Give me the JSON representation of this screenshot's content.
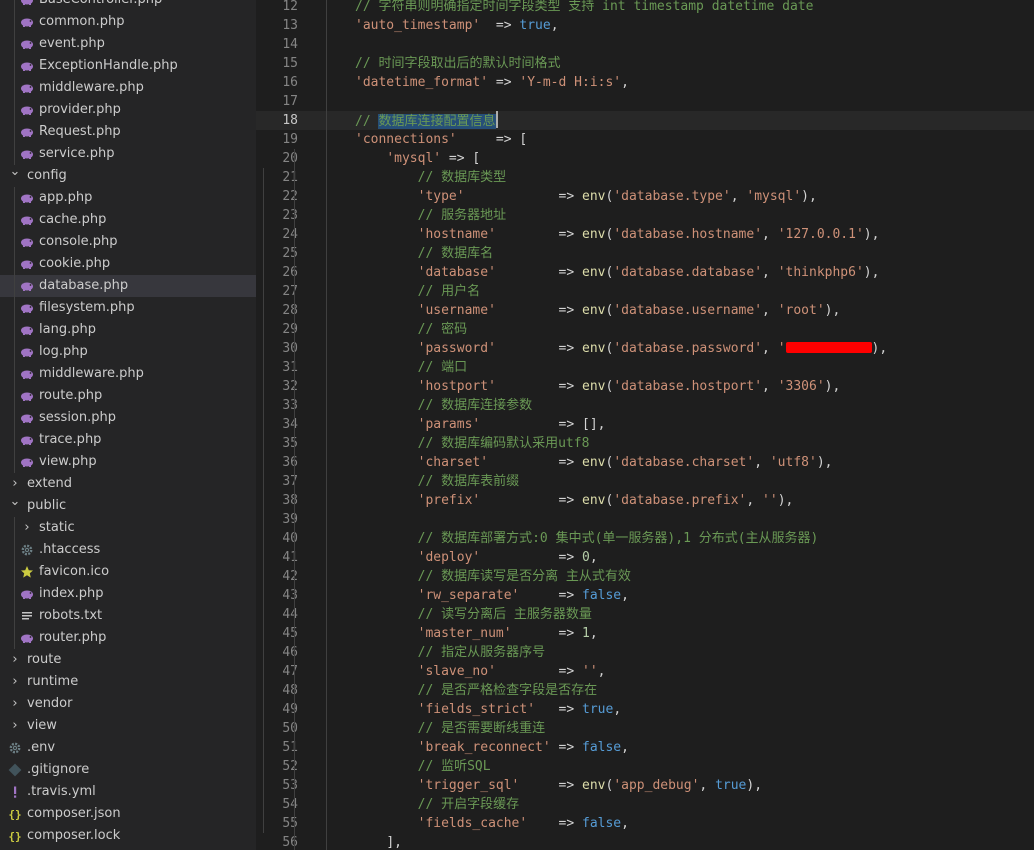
{
  "explorer": {
    "items": [
      {
        "label": "BaseController.php",
        "type": "php",
        "depth": 1
      },
      {
        "label": "common.php",
        "type": "php",
        "depth": 1
      },
      {
        "label": "event.php",
        "type": "php",
        "depth": 1
      },
      {
        "label": "ExceptionHandle.php",
        "type": "php",
        "depth": 1
      },
      {
        "label": "middleware.php",
        "type": "php",
        "depth": 1
      },
      {
        "label": "provider.php",
        "type": "php",
        "depth": 1
      },
      {
        "label": "Request.php",
        "type": "php",
        "depth": 1
      },
      {
        "label": "service.php",
        "type": "php",
        "depth": 1
      },
      {
        "label": "config",
        "type": "folder-open",
        "depth": 0
      },
      {
        "label": "app.php",
        "type": "php",
        "depth": 1
      },
      {
        "label": "cache.php",
        "type": "php",
        "depth": 1
      },
      {
        "label": "console.php",
        "type": "php",
        "depth": 1
      },
      {
        "label": "cookie.php",
        "type": "php",
        "depth": 1
      },
      {
        "label": "database.php",
        "type": "php",
        "depth": 1,
        "selected": true
      },
      {
        "label": "filesystem.php",
        "type": "php",
        "depth": 1
      },
      {
        "label": "lang.php",
        "type": "php",
        "depth": 1
      },
      {
        "label": "log.php",
        "type": "php",
        "depth": 1
      },
      {
        "label": "middleware.php",
        "type": "php",
        "depth": 1
      },
      {
        "label": "route.php",
        "type": "php",
        "depth": 1
      },
      {
        "label": "session.php",
        "type": "php",
        "depth": 1
      },
      {
        "label": "trace.php",
        "type": "php",
        "depth": 1
      },
      {
        "label": "view.php",
        "type": "php",
        "depth": 1
      },
      {
        "label": "extend",
        "type": "folder-closed",
        "depth": 0
      },
      {
        "label": "public",
        "type": "folder-open",
        "depth": 0
      },
      {
        "label": "static",
        "type": "folder-closed",
        "depth": 1
      },
      {
        "label": ".htaccess",
        "type": "gear",
        "depth": 1
      },
      {
        "label": "favicon.ico",
        "type": "star",
        "depth": 1
      },
      {
        "label": "index.php",
        "type": "php",
        "depth": 1
      },
      {
        "label": "robots.txt",
        "type": "text",
        "depth": 1
      },
      {
        "label": "router.php",
        "type": "php",
        "depth": 1
      },
      {
        "label": "route",
        "type": "folder-closed",
        "depth": 0
      },
      {
        "label": "runtime",
        "type": "folder-closed",
        "depth": 0
      },
      {
        "label": "vendor",
        "type": "folder-closed",
        "depth": 0
      },
      {
        "label": "view",
        "type": "folder-closed",
        "depth": 0
      },
      {
        "label": ".env",
        "type": "gear",
        "depth": 0
      },
      {
        "label": ".gitignore",
        "type": "git",
        "depth": 0
      },
      {
        "label": ".travis.yml",
        "type": "yaml",
        "depth": 0
      },
      {
        "label": "composer.json",
        "type": "json",
        "depth": 0
      },
      {
        "label": "composer.lock",
        "type": "json",
        "depth": 0
      }
    ]
  },
  "editor": {
    "current_line": "18",
    "lines": [
      {
        "n": "12",
        "indent": 2,
        "tokens": [
          {
            "t": "// 字符串则明确指定时间字段类型 支持 int timestamp datetime date",
            "c": "cm"
          }
        ]
      },
      {
        "n": "13",
        "indent": 2,
        "tokens": [
          {
            "t": "'auto_timestamp'",
            "c": "st"
          },
          {
            "t": "  => ",
            "c": "pn"
          },
          {
            "t": "true",
            "c": "kw"
          },
          {
            "t": ",",
            "c": "pn"
          }
        ]
      },
      {
        "n": "14",
        "indent": 2,
        "tokens": []
      },
      {
        "n": "15",
        "indent": 2,
        "tokens": [
          {
            "t": "// 时间字段取出后的默认时间格式",
            "c": "cm"
          }
        ]
      },
      {
        "n": "16",
        "indent": 2,
        "tokens": [
          {
            "t": "'datetime_format'",
            "c": "st"
          },
          {
            "t": " => ",
            "c": "pn"
          },
          {
            "t": "'Y-m-d H:i:s'",
            "c": "st"
          },
          {
            "t": ",",
            "c": "pn"
          }
        ]
      },
      {
        "n": "17",
        "indent": 2,
        "tokens": []
      },
      {
        "n": "18",
        "indent": 2,
        "tokens": [
          {
            "t": "// ",
            "c": "cm"
          },
          {
            "t": "数据库连接配置信息",
            "c": "cm",
            "hl": true
          },
          {
            "cursor": true
          }
        ]
      },
      {
        "n": "19",
        "indent": 2,
        "tokens": [
          {
            "t": "'connections'",
            "c": "st"
          },
          {
            "t": "     => [",
            "c": "pn"
          }
        ]
      },
      {
        "n": "20",
        "indent": 3,
        "tokens": [
          {
            "t": "'mysql'",
            "c": "st"
          },
          {
            "t": " => [",
            "c": "pn"
          }
        ]
      },
      {
        "n": "21",
        "indent": 4,
        "tokens": [
          {
            "t": "// 数据库类型",
            "c": "cm"
          }
        ]
      },
      {
        "n": "22",
        "indent": 4,
        "tokens": [
          {
            "t": "'type'",
            "c": "st"
          },
          {
            "t": "            => ",
            "c": "pn"
          },
          {
            "t": "env",
            "c": "fn"
          },
          {
            "t": "(",
            "c": "pn"
          },
          {
            "t": "'database.type'",
            "c": "st"
          },
          {
            "t": ", ",
            "c": "pn"
          },
          {
            "t": "'mysql'",
            "c": "st"
          },
          {
            "t": "),",
            "c": "pn"
          }
        ]
      },
      {
        "n": "23",
        "indent": 4,
        "tokens": [
          {
            "t": "// 服务器地址",
            "c": "cm"
          }
        ]
      },
      {
        "n": "24",
        "indent": 4,
        "tokens": [
          {
            "t": "'hostname'",
            "c": "st"
          },
          {
            "t": "        => ",
            "c": "pn"
          },
          {
            "t": "env",
            "c": "fn"
          },
          {
            "t": "(",
            "c": "pn"
          },
          {
            "t": "'database.hostname'",
            "c": "st"
          },
          {
            "t": ", ",
            "c": "pn"
          },
          {
            "t": "'127.0.0.1'",
            "c": "st"
          },
          {
            "t": "),",
            "c": "pn"
          }
        ]
      },
      {
        "n": "25",
        "indent": 4,
        "tokens": [
          {
            "t": "// 数据库名",
            "c": "cm"
          }
        ]
      },
      {
        "n": "26",
        "indent": 4,
        "tokens": [
          {
            "t": "'database'",
            "c": "st"
          },
          {
            "t": "        => ",
            "c": "pn"
          },
          {
            "t": "env",
            "c": "fn"
          },
          {
            "t": "(",
            "c": "pn"
          },
          {
            "t": "'database.database'",
            "c": "st"
          },
          {
            "t": ", ",
            "c": "pn"
          },
          {
            "t": "'thinkphp6'",
            "c": "st"
          },
          {
            "t": "),",
            "c": "pn"
          }
        ]
      },
      {
        "n": "27",
        "indent": 4,
        "tokens": [
          {
            "t": "// 用户名",
            "c": "cm"
          }
        ]
      },
      {
        "n": "28",
        "indent": 4,
        "tokens": [
          {
            "t": "'username'",
            "c": "st"
          },
          {
            "t": "        => ",
            "c": "pn"
          },
          {
            "t": "env",
            "c": "fn"
          },
          {
            "t": "(",
            "c": "pn"
          },
          {
            "t": "'database.username'",
            "c": "st"
          },
          {
            "t": ", ",
            "c": "pn"
          },
          {
            "t": "'root'",
            "c": "st"
          },
          {
            "t": "),",
            "c": "pn"
          }
        ]
      },
      {
        "n": "29",
        "indent": 4,
        "tokens": [
          {
            "t": "// 密码",
            "c": "cm"
          }
        ]
      },
      {
        "n": "30",
        "indent": 4,
        "tokens": [
          {
            "t": "'password'",
            "c": "st"
          },
          {
            "t": "        => ",
            "c": "pn"
          },
          {
            "t": "env",
            "c": "fn"
          },
          {
            "t": "(",
            "c": "pn"
          },
          {
            "t": "'database.password'",
            "c": "st"
          },
          {
            "t": ", ",
            "c": "pn"
          },
          {
            "t": "'",
            "c": "st"
          },
          {
            "redact": true
          },
          {
            "t": "),",
            "c": "pn"
          }
        ]
      },
      {
        "n": "31",
        "indent": 4,
        "tokens": [
          {
            "t": "// 端口",
            "c": "cm"
          }
        ]
      },
      {
        "n": "32",
        "indent": 4,
        "tokens": [
          {
            "t": "'hostport'",
            "c": "st"
          },
          {
            "t": "        => ",
            "c": "pn"
          },
          {
            "t": "env",
            "c": "fn"
          },
          {
            "t": "(",
            "c": "pn"
          },
          {
            "t": "'database.hostport'",
            "c": "st"
          },
          {
            "t": ", ",
            "c": "pn"
          },
          {
            "t": "'3306'",
            "c": "st"
          },
          {
            "t": "),",
            "c": "pn"
          }
        ]
      },
      {
        "n": "33",
        "indent": 4,
        "tokens": [
          {
            "t": "// 数据库连接参数",
            "c": "cm"
          }
        ]
      },
      {
        "n": "34",
        "indent": 4,
        "tokens": [
          {
            "t": "'params'",
            "c": "st"
          },
          {
            "t": "          => [],",
            "c": "pn"
          }
        ]
      },
      {
        "n": "35",
        "indent": 4,
        "tokens": [
          {
            "t": "// 数据库编码默认采用utf8",
            "c": "cm"
          }
        ]
      },
      {
        "n": "36",
        "indent": 4,
        "tokens": [
          {
            "t": "'charset'",
            "c": "st"
          },
          {
            "t": "         => ",
            "c": "pn"
          },
          {
            "t": "env",
            "c": "fn"
          },
          {
            "t": "(",
            "c": "pn"
          },
          {
            "t": "'database.charset'",
            "c": "st"
          },
          {
            "t": ", ",
            "c": "pn"
          },
          {
            "t": "'utf8'",
            "c": "st"
          },
          {
            "t": "),",
            "c": "pn"
          }
        ]
      },
      {
        "n": "37",
        "indent": 4,
        "tokens": [
          {
            "t": "// 数据库表前缀",
            "c": "cm"
          }
        ]
      },
      {
        "n": "38",
        "indent": 4,
        "tokens": [
          {
            "t": "'prefix'",
            "c": "st"
          },
          {
            "t": "          => ",
            "c": "pn"
          },
          {
            "t": "env",
            "c": "fn"
          },
          {
            "t": "(",
            "c": "pn"
          },
          {
            "t": "'database.prefix'",
            "c": "st"
          },
          {
            "t": ", ",
            "c": "pn"
          },
          {
            "t": "''",
            "c": "st"
          },
          {
            "t": "),",
            "c": "pn"
          }
        ]
      },
      {
        "n": "39",
        "indent": 4,
        "tokens": []
      },
      {
        "n": "40",
        "indent": 4,
        "tokens": [
          {
            "t": "// 数据库部署方式:0 集中式(单一服务器),1 分布式(主从服务器)",
            "c": "cm"
          }
        ]
      },
      {
        "n": "41",
        "indent": 4,
        "tokens": [
          {
            "t": "'deploy'",
            "c": "st"
          },
          {
            "t": "          => ",
            "c": "pn"
          },
          {
            "t": "0",
            "c": "nu"
          },
          {
            "t": ",",
            "c": "pn"
          }
        ]
      },
      {
        "n": "42",
        "indent": 4,
        "tokens": [
          {
            "t": "// 数据库读写是否分离 主从式有效",
            "c": "cm"
          }
        ]
      },
      {
        "n": "43",
        "indent": 4,
        "tokens": [
          {
            "t": "'rw_separate'",
            "c": "st"
          },
          {
            "t": "     => ",
            "c": "pn"
          },
          {
            "t": "false",
            "c": "kw"
          },
          {
            "t": ",",
            "c": "pn"
          }
        ]
      },
      {
        "n": "44",
        "indent": 4,
        "tokens": [
          {
            "t": "// 读写分离后 主服务器数量",
            "c": "cm"
          }
        ]
      },
      {
        "n": "45",
        "indent": 4,
        "tokens": [
          {
            "t": "'master_num'",
            "c": "st"
          },
          {
            "t": "      => ",
            "c": "pn"
          },
          {
            "t": "1",
            "c": "nu"
          },
          {
            "t": ",",
            "c": "pn"
          }
        ]
      },
      {
        "n": "46",
        "indent": 4,
        "tokens": [
          {
            "t": "// 指定从服务器序号",
            "c": "cm"
          }
        ]
      },
      {
        "n": "47",
        "indent": 4,
        "tokens": [
          {
            "t": "'slave_no'",
            "c": "st"
          },
          {
            "t": "        => ",
            "c": "pn"
          },
          {
            "t": "''",
            "c": "st"
          },
          {
            "t": ",",
            "c": "pn"
          }
        ]
      },
      {
        "n": "48",
        "indent": 4,
        "tokens": [
          {
            "t": "// 是否严格检查字段是否存在",
            "c": "cm"
          }
        ]
      },
      {
        "n": "49",
        "indent": 4,
        "tokens": [
          {
            "t": "'fields_strict'",
            "c": "st"
          },
          {
            "t": "   => ",
            "c": "pn"
          },
          {
            "t": "true",
            "c": "kw"
          },
          {
            "t": ",",
            "c": "pn"
          }
        ]
      },
      {
        "n": "50",
        "indent": 4,
        "tokens": [
          {
            "t": "// 是否需要断线重连",
            "c": "cm"
          }
        ]
      },
      {
        "n": "51",
        "indent": 4,
        "tokens": [
          {
            "t": "'break_reconnect'",
            "c": "st"
          },
          {
            "t": " => ",
            "c": "pn"
          },
          {
            "t": "false",
            "c": "kw"
          },
          {
            "t": ",",
            "c": "pn"
          }
        ]
      },
      {
        "n": "52",
        "indent": 4,
        "tokens": [
          {
            "t": "// 监听SQL",
            "c": "cm"
          }
        ]
      },
      {
        "n": "53",
        "indent": 4,
        "tokens": [
          {
            "t": "'trigger_sql'",
            "c": "st"
          },
          {
            "t": "     => ",
            "c": "pn"
          },
          {
            "t": "env",
            "c": "fn"
          },
          {
            "t": "(",
            "c": "pn"
          },
          {
            "t": "'app_debug'",
            "c": "st"
          },
          {
            "t": ", ",
            "c": "pn"
          },
          {
            "t": "true",
            "c": "kw"
          },
          {
            "t": "),",
            "c": "pn"
          }
        ]
      },
      {
        "n": "54",
        "indent": 4,
        "tokens": [
          {
            "t": "// 开启字段缓存",
            "c": "cm"
          }
        ]
      },
      {
        "n": "55",
        "indent": 4,
        "tokens": [
          {
            "t": "'fields_cache'",
            "c": "st"
          },
          {
            "t": "    => ",
            "c": "pn"
          },
          {
            "t": "false",
            "c": "kw"
          },
          {
            "t": ",",
            "c": "pn"
          }
        ]
      },
      {
        "n": "56",
        "indent": 3,
        "tokens": [
          {
            "t": "],",
            "c": "pn"
          }
        ]
      }
    ]
  },
  "colors": {
    "php_icon": "#a074c4",
    "folder_chevron": "#c5c5c5",
    "gear_icon": "#6d8086",
    "star_icon": "#cbcb41",
    "yaml_icon": "#a074c4",
    "json_icon": "#cbcb41",
    "git_icon": "#41535b",
    "redaction": "#ff0000"
  }
}
